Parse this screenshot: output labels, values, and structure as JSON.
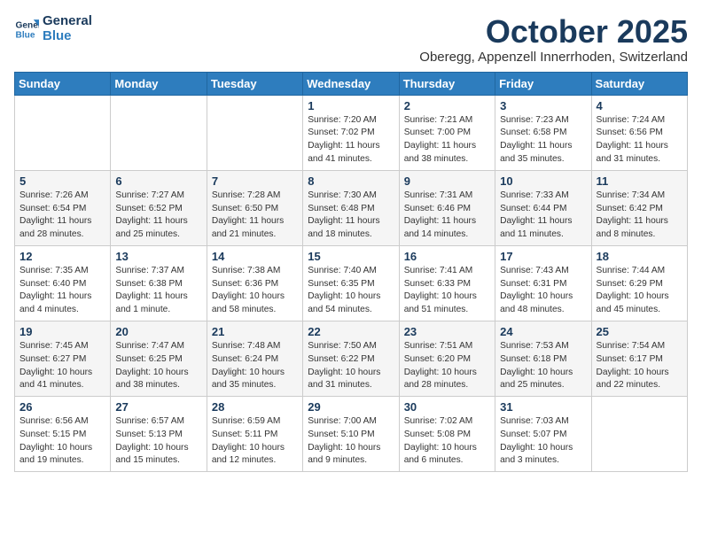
{
  "logo": {
    "line1": "General",
    "line2": "Blue"
  },
  "title": "October 2025",
  "location": "Oberegg, Appenzell Innerrhoden, Switzerland",
  "days_of_week": [
    "Sunday",
    "Monday",
    "Tuesday",
    "Wednesday",
    "Thursday",
    "Friday",
    "Saturday"
  ],
  "weeks": [
    [
      {
        "day": "",
        "info": ""
      },
      {
        "day": "",
        "info": ""
      },
      {
        "day": "",
        "info": ""
      },
      {
        "day": "1",
        "info": "Sunrise: 7:20 AM\nSunset: 7:02 PM\nDaylight: 11 hours and 41 minutes."
      },
      {
        "day": "2",
        "info": "Sunrise: 7:21 AM\nSunset: 7:00 PM\nDaylight: 11 hours and 38 minutes."
      },
      {
        "day": "3",
        "info": "Sunrise: 7:23 AM\nSunset: 6:58 PM\nDaylight: 11 hours and 35 minutes."
      },
      {
        "day": "4",
        "info": "Sunrise: 7:24 AM\nSunset: 6:56 PM\nDaylight: 11 hours and 31 minutes."
      }
    ],
    [
      {
        "day": "5",
        "info": "Sunrise: 7:26 AM\nSunset: 6:54 PM\nDaylight: 11 hours and 28 minutes."
      },
      {
        "day": "6",
        "info": "Sunrise: 7:27 AM\nSunset: 6:52 PM\nDaylight: 11 hours and 25 minutes."
      },
      {
        "day": "7",
        "info": "Sunrise: 7:28 AM\nSunset: 6:50 PM\nDaylight: 11 hours and 21 minutes."
      },
      {
        "day": "8",
        "info": "Sunrise: 7:30 AM\nSunset: 6:48 PM\nDaylight: 11 hours and 18 minutes."
      },
      {
        "day": "9",
        "info": "Sunrise: 7:31 AM\nSunset: 6:46 PM\nDaylight: 11 hours and 14 minutes."
      },
      {
        "day": "10",
        "info": "Sunrise: 7:33 AM\nSunset: 6:44 PM\nDaylight: 11 hours and 11 minutes."
      },
      {
        "day": "11",
        "info": "Sunrise: 7:34 AM\nSunset: 6:42 PM\nDaylight: 11 hours and 8 minutes."
      }
    ],
    [
      {
        "day": "12",
        "info": "Sunrise: 7:35 AM\nSunset: 6:40 PM\nDaylight: 11 hours and 4 minutes."
      },
      {
        "day": "13",
        "info": "Sunrise: 7:37 AM\nSunset: 6:38 PM\nDaylight: 11 hours and 1 minute."
      },
      {
        "day": "14",
        "info": "Sunrise: 7:38 AM\nSunset: 6:36 PM\nDaylight: 10 hours and 58 minutes."
      },
      {
        "day": "15",
        "info": "Sunrise: 7:40 AM\nSunset: 6:35 PM\nDaylight: 10 hours and 54 minutes."
      },
      {
        "day": "16",
        "info": "Sunrise: 7:41 AM\nSunset: 6:33 PM\nDaylight: 10 hours and 51 minutes."
      },
      {
        "day": "17",
        "info": "Sunrise: 7:43 AM\nSunset: 6:31 PM\nDaylight: 10 hours and 48 minutes."
      },
      {
        "day": "18",
        "info": "Sunrise: 7:44 AM\nSunset: 6:29 PM\nDaylight: 10 hours and 45 minutes."
      }
    ],
    [
      {
        "day": "19",
        "info": "Sunrise: 7:45 AM\nSunset: 6:27 PM\nDaylight: 10 hours and 41 minutes."
      },
      {
        "day": "20",
        "info": "Sunrise: 7:47 AM\nSunset: 6:25 PM\nDaylight: 10 hours and 38 minutes."
      },
      {
        "day": "21",
        "info": "Sunrise: 7:48 AM\nSunset: 6:24 PM\nDaylight: 10 hours and 35 minutes."
      },
      {
        "day": "22",
        "info": "Sunrise: 7:50 AM\nSunset: 6:22 PM\nDaylight: 10 hours and 31 minutes."
      },
      {
        "day": "23",
        "info": "Sunrise: 7:51 AM\nSunset: 6:20 PM\nDaylight: 10 hours and 28 minutes."
      },
      {
        "day": "24",
        "info": "Sunrise: 7:53 AM\nSunset: 6:18 PM\nDaylight: 10 hours and 25 minutes."
      },
      {
        "day": "25",
        "info": "Sunrise: 7:54 AM\nSunset: 6:17 PM\nDaylight: 10 hours and 22 minutes."
      }
    ],
    [
      {
        "day": "26",
        "info": "Sunrise: 6:56 AM\nSunset: 5:15 PM\nDaylight: 10 hours and 19 minutes."
      },
      {
        "day": "27",
        "info": "Sunrise: 6:57 AM\nSunset: 5:13 PM\nDaylight: 10 hours and 15 minutes."
      },
      {
        "day": "28",
        "info": "Sunrise: 6:59 AM\nSunset: 5:11 PM\nDaylight: 10 hours and 12 minutes."
      },
      {
        "day": "29",
        "info": "Sunrise: 7:00 AM\nSunset: 5:10 PM\nDaylight: 10 hours and 9 minutes."
      },
      {
        "day": "30",
        "info": "Sunrise: 7:02 AM\nSunset: 5:08 PM\nDaylight: 10 hours and 6 minutes."
      },
      {
        "day": "31",
        "info": "Sunrise: 7:03 AM\nSunset: 5:07 PM\nDaylight: 10 hours and 3 minutes."
      },
      {
        "day": "",
        "info": ""
      }
    ]
  ]
}
